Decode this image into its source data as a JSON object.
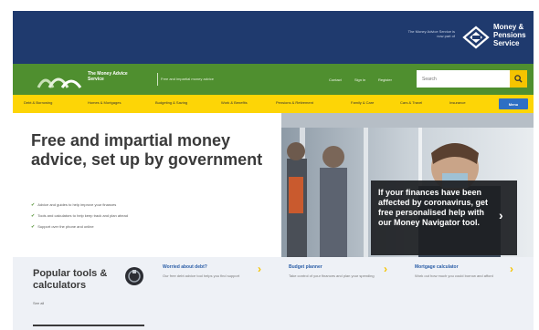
{
  "header": {
    "mas_small_text": "The Money Advice Service is now part of",
    "mas_name": "Money & Pensions Service",
    "brand": "The Money Advice Service",
    "tagline": "Free and impartial money advice",
    "util_links": [
      "Contact",
      "Sign in",
      "Register"
    ],
    "search_placeholder": "Search"
  },
  "nav": {
    "items": [
      "Debt & Borrowing",
      "Homes & Mortgages",
      "Budgeting & Saving",
      "Work & Benefits",
      "Pensions & Retirement",
      "Family & Care",
      "Cars & Travel",
      "Insurance"
    ],
    "button": "Menu"
  },
  "hero": {
    "title": "Free and impartial money advice, set up by government",
    "bullets": [
      "Advice and guides to help improve your finances",
      "Tools and calculators to help keep track and plan ahead",
      "Support over the phone and online"
    ],
    "overlay": "If your finances have been affected by coronavirus, get free personalised help with our Money Navigator tool."
  },
  "tools": {
    "title": "Popular tools & calculators",
    "see_all": "See all",
    "cards": [
      {
        "name": "Worried about debt?",
        "desc": "Our free debt advice tool helps you find support"
      },
      {
        "name": "Budget planner",
        "desc": "Take control of your finances and plan your spending"
      },
      {
        "name": "Mortgage calculator",
        "desc": "Work out how much you could borrow and afford"
      }
    ]
  },
  "colors": {
    "navy": "#1f3a6e",
    "green": "#4f8f2f",
    "yellow": "#fdd506",
    "blue_button": "#2e6fc4"
  }
}
